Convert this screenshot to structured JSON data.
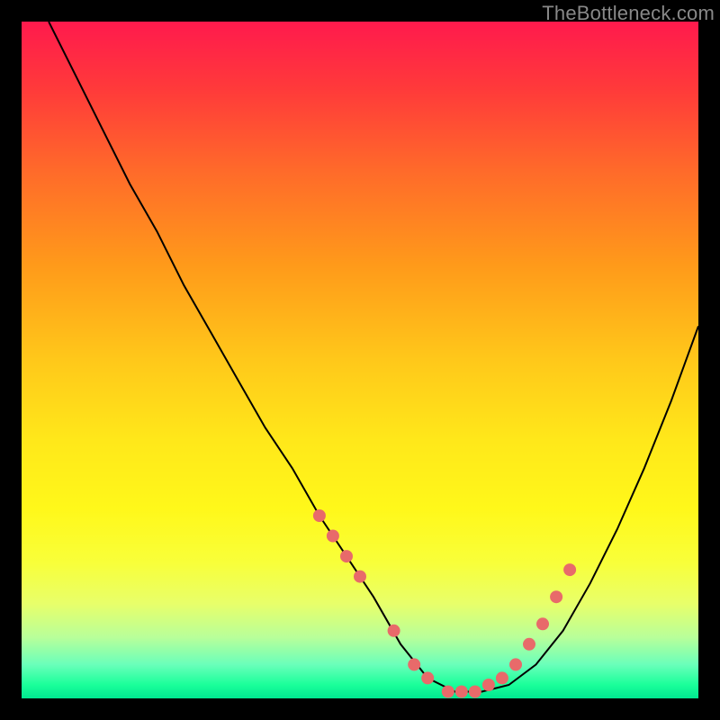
{
  "watermark": "TheBottleneck.com",
  "chart_data": {
    "type": "line",
    "title": "",
    "xlabel": "",
    "ylabel": "",
    "xlim": [
      0,
      100
    ],
    "ylim": [
      0,
      100
    ],
    "grid": false,
    "legend": false,
    "series": [
      {
        "name": "bottleneck-curve",
        "x": [
          4,
          8,
          12,
          16,
          20,
          24,
          28,
          32,
          36,
          40,
          44,
          48,
          52,
          56,
          60,
          64,
          68,
          72,
          76,
          80,
          84,
          88,
          92,
          96,
          100
        ],
        "y": [
          100,
          92,
          84,
          76,
          69,
          61,
          54,
          47,
          40,
          34,
          27,
          21,
          15,
          8,
          3,
          1,
          1,
          2,
          5,
          10,
          17,
          25,
          34,
          44,
          55
        ]
      }
    ],
    "highlight_points": {
      "name": "curve-dots",
      "color": "#e86a6a",
      "x": [
        44,
        46,
        48,
        50,
        55,
        58,
        60,
        63,
        65,
        67,
        69,
        71,
        73,
        75,
        77,
        79,
        81
      ],
      "y": [
        27,
        24,
        21,
        18,
        10,
        5,
        3,
        1,
        1,
        1,
        2,
        3,
        5,
        8,
        11,
        15,
        19
      ]
    }
  }
}
